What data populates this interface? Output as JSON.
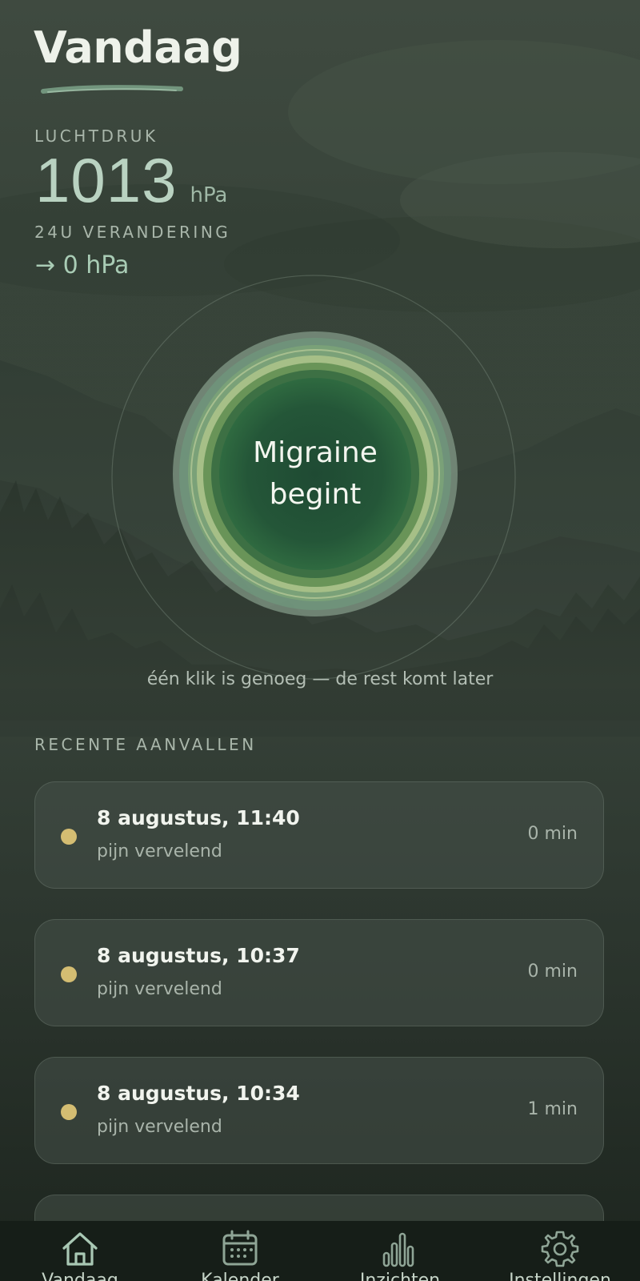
{
  "header": {
    "title": "Vandaag"
  },
  "pressure": {
    "label": "LUCHTDRUK",
    "value": "1013",
    "unit": "hPa",
    "change_label": "24U VERANDERING",
    "change_value": "→ 0 hPa"
  },
  "migraine_button": {
    "label": "Migraine\nbegint",
    "hint": "één klik is genoeg — de rest komt later"
  },
  "recent": {
    "label": "RECENTE AANVALLEN",
    "items": [
      {
        "date": "8 augustus, 11:40",
        "pain": "pijn vervelend",
        "duration": "0 min"
      },
      {
        "date": "8 augustus, 10:37",
        "pain": "pijn vervelend",
        "duration": "0 min"
      },
      {
        "date": "8 augustus, 10:34",
        "pain": "pijn vervelend",
        "duration": "1 min"
      }
    ]
  },
  "nav": {
    "items": [
      {
        "label": "Vandaag",
        "icon": "home-icon"
      },
      {
        "label": "Kalender",
        "icon": "calendar-icon"
      },
      {
        "label": "Inzichten",
        "icon": "bar-chart-icon"
      },
      {
        "label": "Instellingen",
        "icon": "gear-icon"
      }
    ]
  },
  "colors": {
    "accent": "#b9d2c1",
    "dot": "#d4bd72",
    "nav_bg": "#161e18"
  }
}
